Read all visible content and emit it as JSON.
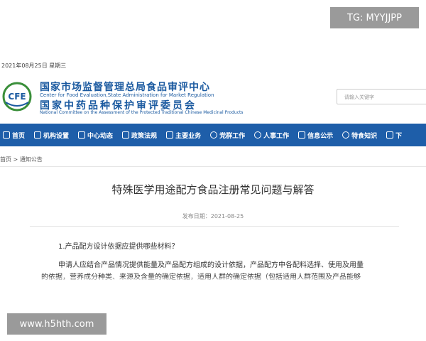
{
  "watermarks": {
    "tg": "TG: MYYJJPP",
    "site": "www.h5hth.com"
  },
  "header": {
    "date": "2021年08月25日 星期三",
    "logo_text": "CFE",
    "org_cn_1": "国家市场监督管理总局食品审评中心",
    "org_en_1": "Center for Food Evaluation,State Administration for Market Regulation",
    "org_cn_2": "国家中药品种保护审评委员会",
    "org_en_2": "National Committee on the Assessment of the Protected Traditional Chinese Medicinal Products",
    "search_placeholder": "请输入关键字"
  },
  "nav": [
    {
      "label": "首页",
      "icon": "home-icon"
    },
    {
      "label": "机构设置",
      "icon": "org-icon"
    },
    {
      "label": "中心动态",
      "icon": "news-icon"
    },
    {
      "label": "政策法规",
      "icon": "book-icon"
    },
    {
      "label": "主要业务",
      "icon": "building-icon"
    },
    {
      "label": "党群工作",
      "icon": "person-icon"
    },
    {
      "label": "人事工作",
      "icon": "people-icon"
    },
    {
      "label": "信息公示",
      "icon": "info-icon"
    },
    {
      "label": "特食知识",
      "icon": "bulb-icon"
    },
    {
      "label": "下",
      "icon": "download-icon"
    }
  ],
  "breadcrumb": {
    "home": "首页",
    "sep": " > ",
    "current": "通知公告"
  },
  "article": {
    "title": "特殊医学用途配方食品注册常见问题与解答",
    "publish_date": "发布日期：2021-08-25",
    "q1": "1.产品配方设计依据应提供哪些材料？",
    "p1": "申请人应结合产品情况提供能量及产品配方组成的设计依据，产品配方中各配料选择、使用及用量",
    "p2": "的依据，营养成分种类、来源及含量的确定依据，适用人群的确定依据（包括适用人群范围及产品能够"
  },
  "colors": {
    "nav_bg": "#1e5ea9",
    "brand_blue": "#1b5aa0",
    "logo_green": "#3a8f3a"
  }
}
